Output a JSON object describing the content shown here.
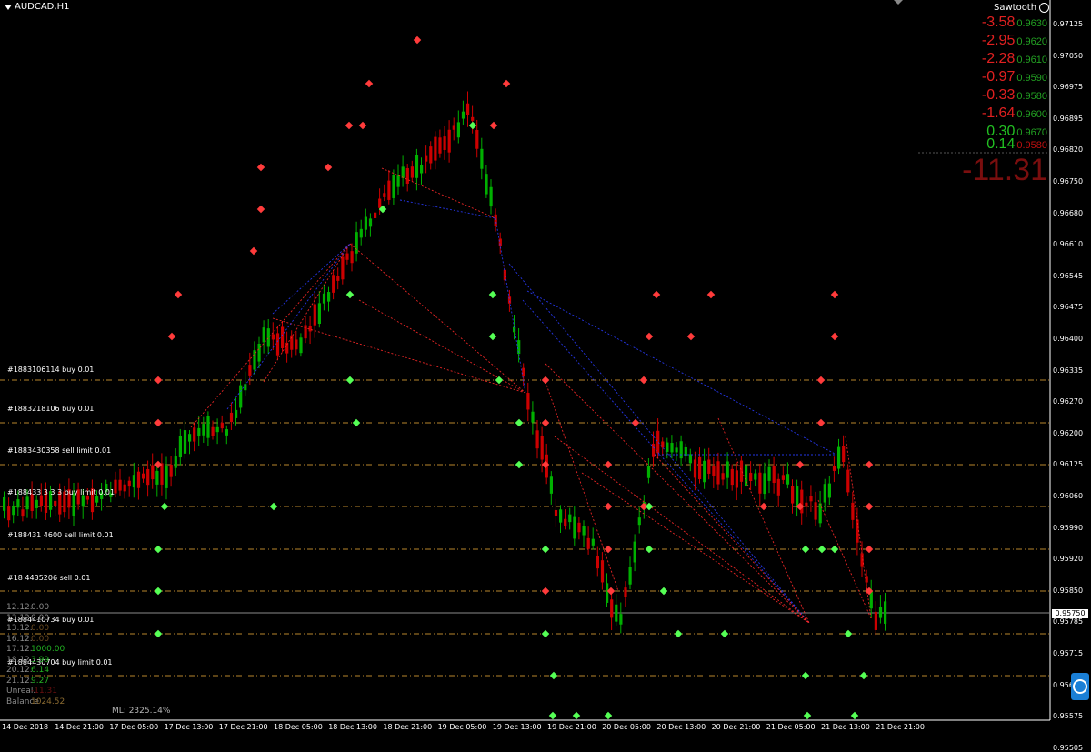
{
  "window": {
    "title": "AUDCAD,H1",
    "indicator_name": "Sawtooth"
  },
  "colors": {
    "bull": "#00b000",
    "bear": "#cc0000",
    "wick": "#00b000",
    "level_line": "#b8862d",
    "current_price_line": "#8a8a8a",
    "red_dotted": "#ff2a2a",
    "blue_dotted": "#2a3cff"
  },
  "panel": {
    "rows": [
      {
        "value": "-3.58",
        "price": "0.9630",
        "value_color": "#e02020",
        "price_color": "#22a022"
      },
      {
        "value": "-2.95",
        "price": "0.9620",
        "value_color": "#e02020",
        "price_color": "#22a022"
      },
      {
        "value": "-2.28",
        "price": "0.9610",
        "value_color": "#e02020",
        "price_color": "#22a022"
      },
      {
        "value": "-0.97",
        "price": "0.9590",
        "value_color": "#e02020",
        "price_color": "#22a022"
      },
      {
        "value": "-0.33",
        "price": "0.9580",
        "value_color": "#e02020",
        "price_color": "#22a022"
      },
      {
        "value": "-1.64",
        "price": "0.9600",
        "value_color": "#e02020",
        "price_color": "#22a022"
      },
      {
        "value": "0.30",
        "price": "0.9670",
        "value_color": "#22c022",
        "price_color": "#22a022"
      },
      {
        "value": "0.14",
        "price": "0.9580",
        "value_color": "#22c022",
        "price_color": "#c01010"
      }
    ],
    "total": "-11.31"
  },
  "orders": [
    {
      "label": "#1883106114 buy 0.01"
    },
    {
      "label": "#1883218106 buy 0.01"
    },
    {
      "label": "#1883430358 sell limit 0.01"
    },
    {
      "label": "#188433 3 3 3 buy limit 0.01"
    },
    {
      "label": "#188431 4600 sell limit 0.01"
    },
    {
      "label": "#18 4435206 sell 0.01"
    },
    {
      "label": "#1884410734 buy 0.01"
    },
    {
      "label": "#1884430704 buy limit 0.01"
    }
  ],
  "history": [
    {
      "date": "12.12.",
      "value": "0.00",
      "color": "#8a8a8a"
    },
    {
      "date": "13.12.",
      "value": "0.00",
      "color": "#8a8a8a"
    },
    {
      "date": "13.12.",
      "value": "0.00",
      "color": "#6a4a20"
    },
    {
      "date": "16.12.",
      "value": "0.00",
      "color": "#6a4a20"
    },
    {
      "date": "17.12.",
      "value": "1000.00",
      "color": "#22b022"
    },
    {
      "date": "18.12.",
      "value": "3.99",
      "color": "#22b022"
    },
    {
      "date": "20.12.",
      "value": "6.14",
      "color": "#22b022"
    },
    {
      "date": "21.12.",
      "value": "9.27",
      "color": "#22b022"
    },
    {
      "date": "Unreal.",
      "value": "-11.31",
      "color": "#6a1010"
    },
    {
      "date": "Balance",
      "value": "1024.52",
      "color": "#8a6a30"
    }
  ],
  "ml": {
    "label": "ML:",
    "value": "2325.14%"
  },
  "price_axis": [
    "0.97125",
    "0.97050",
    "0.96975",
    "0.96895",
    "0.96820",
    "0.96750",
    "0.96680",
    "0.96610",
    "0.96545",
    "0.96475",
    "0.96400",
    "0.96335",
    "0.96270",
    "0.96200",
    "0.96125",
    "0.96060",
    "0.95990",
    "0.95920",
    "0.95850",
    "0.95785",
    "0.95715",
    "0.95645",
    "0.95575",
    "0.95505"
  ],
  "current_price": "0.95750",
  "time_axis": [
    "14 Dec 2018",
    "14 Dec 21:00",
    "17 Dec 05:00",
    "17 Dec 13:00",
    "17 Dec 21:00",
    "18 Dec 05:00",
    "18 Dec 13:00",
    "18 Dec 21:00",
    "19 Dec 05:00",
    "19 Dec 13:00",
    "19 Dec 21:00",
    "20 Dec 05:00",
    "20 Dec 13:00",
    "20 Dec 21:00",
    "21 Dec 05:00",
    "21 Dec 13:00",
    "21 Dec 21:00"
  ]
}
